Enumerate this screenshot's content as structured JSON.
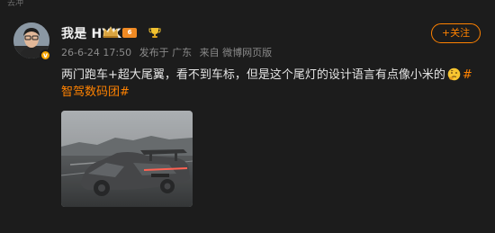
{
  "top_fragment": "去冲",
  "post": {
    "username": "我是 HYK",
    "level": "6",
    "verified_mark": "v",
    "meta": {
      "time": "26-6-24 17:50",
      "location": "发布于 广东",
      "source": "来自 微博网页版"
    },
    "follow_label": "+关注",
    "text": "两门跑车+超大尾翼，看不到车标，但是这个尾灯的设计语言有点像小米的",
    "hashtag": "#智驾数码团#"
  },
  "colors": {
    "accent": "#ff8200",
    "background": "#1c1c1c",
    "meta_text": "#8a8a8a"
  },
  "icons": [
    "crown-icon",
    "level-badge",
    "thinking-emoji-icon",
    "verified-icon"
  ]
}
